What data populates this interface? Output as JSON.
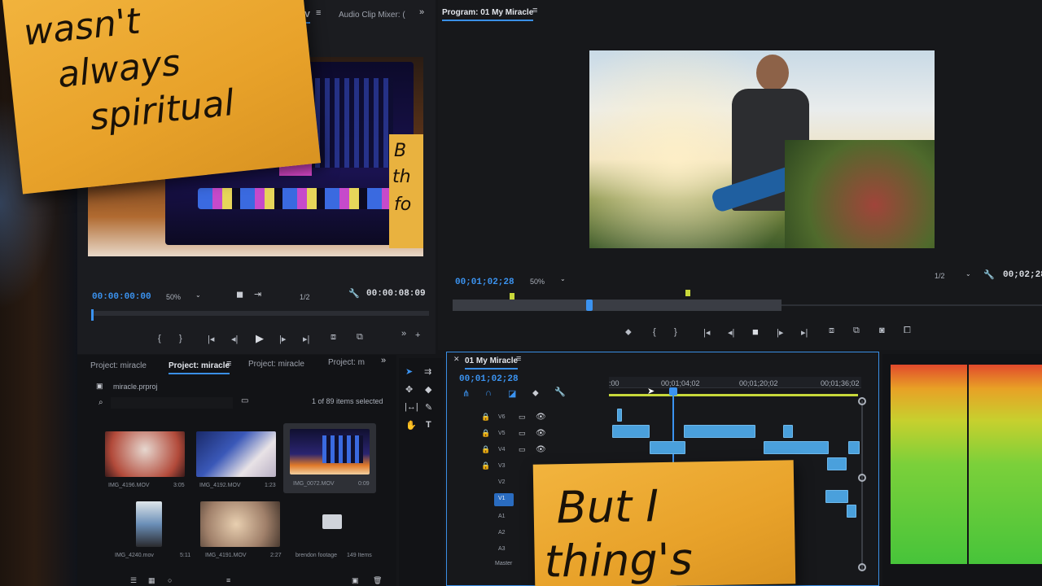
{
  "source_monitor": {
    "tab_partial": "MOV",
    "audio_mixer_tab": "Audio Clip Mixer: (",
    "timecode": "00:00:00:00",
    "zoom": "50%",
    "resolution": "1/2",
    "duration": "00:00:08:09"
  },
  "program_monitor": {
    "title": "Program: 01 My Miracle",
    "timecode": "00;01;02;28",
    "zoom": "50%",
    "resolution": "1/2",
    "duration_partial": "00;02;28"
  },
  "project_panel": {
    "tabs": [
      "Project: miracle",
      "Project: miracle",
      "Project: miracle",
      "Project: m"
    ],
    "active_tab_index": 1,
    "file_name": "miracle.prproj",
    "selection_status": "1 of 89 items selected",
    "items": [
      {
        "name": "IMG_4196.MOV",
        "duration": "3:05"
      },
      {
        "name": "IMG_4192.MOV",
        "duration": "1:23"
      },
      {
        "name": "IMG_0072.MOV",
        "duration": "0:09"
      },
      {
        "name": "IMG_4240.mov",
        "duration": "5:11"
      },
      {
        "name": "IMG_4191.MOV",
        "duration": "2:27"
      },
      {
        "name": "brendon footage",
        "duration": "149 Items"
      }
    ]
  },
  "timeline": {
    "title": "01 My Miracle",
    "timecode": "00;01;02;28",
    "ruler_labels": [
      ":00",
      "00;01;04;02",
      "00;01;20;02",
      "00;01;36;02"
    ],
    "video_tracks": [
      "V6",
      "V5",
      "V4",
      "V3",
      "V2",
      "V1"
    ],
    "audio_tracks": [
      "A1",
      "A2",
      "A3"
    ],
    "master_label": "Master"
  },
  "sticky_notes": {
    "top_left": [
      "wasn't",
      "always",
      "spiritual"
    ],
    "bottom": [
      "But I",
      "thing's"
    ],
    "behind_partial": [
      "B",
      "th",
      "fo"
    ]
  },
  "colors": {
    "timecode_blue": "#3b93f0",
    "clip_blue": "#4aa0dc",
    "sticky_yellow": "#f2b43e",
    "panel_dark": "#1b1c20"
  }
}
